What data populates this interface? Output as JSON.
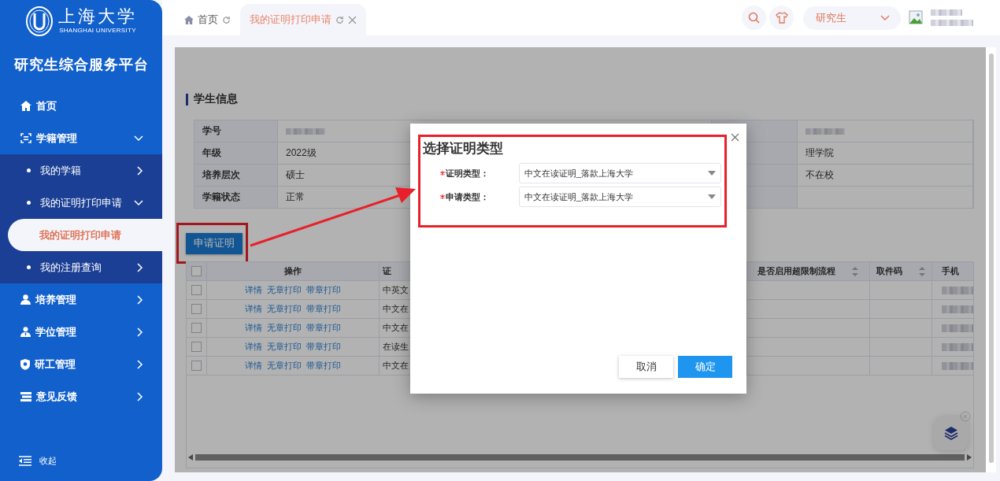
{
  "sidebar": {
    "logo_text": "上海大学",
    "logo_subtitle": "SHANGHAI UNIVERSITY",
    "title": "研究生综合服务平台",
    "menu": [
      {
        "label": "首页",
        "kind": "link"
      },
      {
        "label": "学籍管理",
        "kind": "group",
        "expanded": true,
        "children": [
          {
            "label": "我的学籍",
            "kind": "group",
            "expanded": false
          },
          {
            "label": "我的证明打印申请",
            "kind": "group",
            "expanded": true,
            "children": [
              {
                "label": "我的证明打印申请",
                "selected": true
              }
            ]
          },
          {
            "label": "我的注册查询",
            "kind": "group",
            "expanded": false
          }
        ]
      },
      {
        "label": "培养管理",
        "kind": "group",
        "expanded": false
      },
      {
        "label": "学位管理",
        "kind": "group",
        "expanded": false
      },
      {
        "label": "研工管理",
        "kind": "group",
        "expanded": false
      },
      {
        "label": "意见反馈",
        "kind": "group",
        "expanded": false
      }
    ],
    "collapse_label": "收起"
  },
  "tabs": [
    {
      "label": "首页",
      "selected": false,
      "closable": false
    },
    {
      "label": "我的证明打印申请",
      "selected": true,
      "closable": true
    }
  ],
  "header": {
    "role_select": "研究生"
  },
  "student_info": {
    "title": "学生信息",
    "rows": [
      {
        "label": "学号",
        "value": {
          "blurred": true
        },
        "value_2": {
          "blurred": true
        }
      },
      {
        "label": "年级",
        "value": {
          "text": "2022级"
        },
        "value_2": {
          "text": "理学院"
        }
      },
      {
        "label": "培养层次",
        "value": {
          "text": "硕士"
        },
        "value_2": {
          "text": "不在校"
        }
      },
      {
        "label": "学籍状态",
        "value": {
          "text": "正常"
        }
      }
    ]
  },
  "apply_button": "申请证明",
  "table": {
    "header_checked": false,
    "columns": [
      {
        "title": "操作",
        "sortable": false
      },
      {
        "title": "证",
        "sortable": false
      },
      {
        "title": "是否启用超限制流程",
        "sortable": true
      },
      {
        "title": "取件码",
        "sortable": true
      },
      {
        "title": "手机",
        "sortable": false
      }
    ],
    "rows": [
      {
        "checked": false,
        "actions": [
          "详情",
          "无章打印",
          "带章打印"
        ],
        "column_3": "中英文"
      },
      {
        "checked": false,
        "actions": [
          "详情",
          "无章打印",
          "带章打印"
        ],
        "column_3": "中文在"
      },
      {
        "checked": false,
        "actions": [
          "详情",
          "无章打印",
          "带章打印"
        ],
        "column_3": "中文在"
      },
      {
        "checked": false,
        "actions": [
          "详情",
          "无章打印",
          "带章打印"
        ],
        "column_3": "在读生"
      },
      {
        "checked": false,
        "actions": [
          "详情",
          "无章打印",
          "带章打印"
        ],
        "column_3": "中文在"
      }
    ]
  },
  "dialog": {
    "title": "选择证明类型",
    "fields": [
      {
        "label": "证明类型：",
        "required": true,
        "value": "中文在读证明_落款上海大学"
      },
      {
        "label": "申请类型：",
        "required": true,
        "value": "中文在读证明_落款上海大学"
      }
    ],
    "buttons": [
      {
        "label": "取消",
        "kind": "default"
      },
      {
        "label": "确定",
        "kind": "primary"
      }
    ]
  }
}
